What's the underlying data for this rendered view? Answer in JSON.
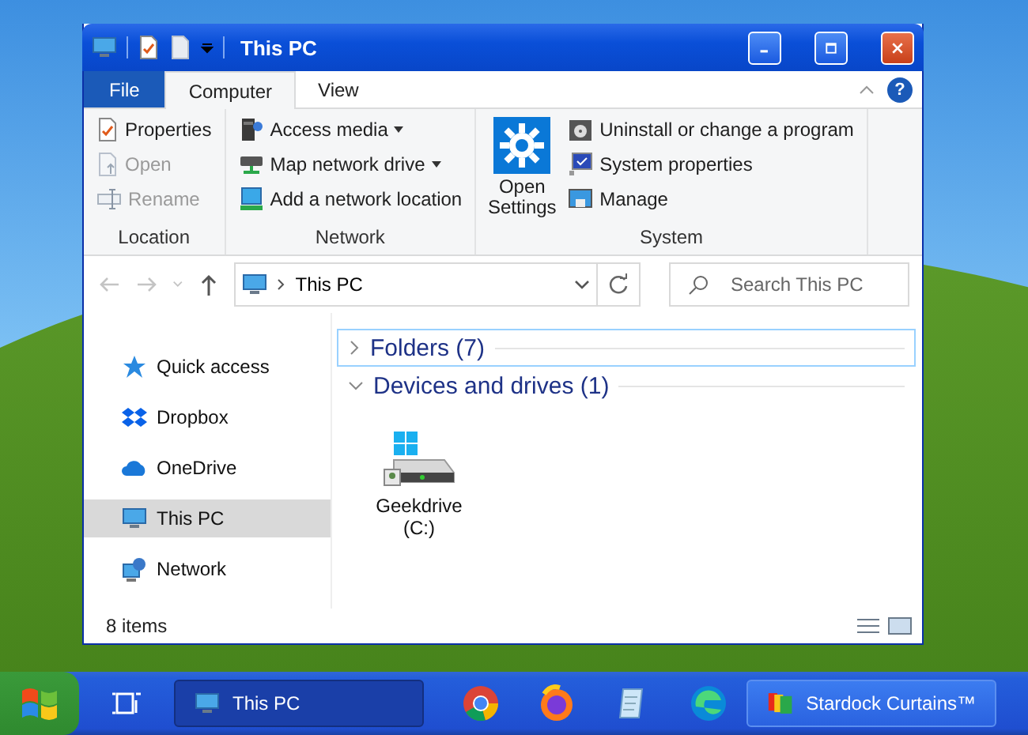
{
  "window": {
    "title": "This PC"
  },
  "ribbon_tabs": [
    {
      "label": "File",
      "kind": "file",
      "selected": false
    },
    {
      "label": "Computer",
      "kind": "tab",
      "selected": true
    },
    {
      "label": "View",
      "kind": "tab",
      "selected": false
    }
  ],
  "help_button": "?",
  "ribbon_groups": [
    {
      "label": "Location",
      "items": [
        {
          "label": "Properties",
          "kind": "small",
          "disabled": false,
          "dropdown": false
        },
        {
          "label": "Open",
          "kind": "small",
          "disabled": true,
          "dropdown": false
        },
        {
          "label": "Rename",
          "kind": "small",
          "disabled": true,
          "dropdown": false
        }
      ]
    },
    {
      "label": "Network",
      "items": [
        {
          "label": "Access media",
          "kind": "small",
          "disabled": false,
          "dropdown": true
        },
        {
          "label": "Map network drive",
          "kind": "small",
          "disabled": false,
          "dropdown": true
        },
        {
          "label": "Add a network location",
          "kind": "small",
          "disabled": false,
          "dropdown": false
        }
      ]
    },
    {
      "label": "System",
      "items": [
        {
          "label": "Open Settings",
          "kind": "large",
          "disabled": false,
          "dropdown": false
        },
        {
          "label": "Uninstall or change a program",
          "kind": "small",
          "disabled": false,
          "dropdown": false
        },
        {
          "label": "System properties",
          "kind": "small",
          "disabled": false,
          "dropdown": false
        },
        {
          "label": "Manage",
          "kind": "small",
          "disabled": false,
          "dropdown": false
        }
      ]
    }
  ],
  "navigation": {
    "back_disabled": true,
    "forward_disabled": true,
    "up_disabled": false
  },
  "address_bar": {
    "path": "This PC"
  },
  "search": {
    "placeholder": "Search This PC"
  },
  "sidebar": {
    "items": [
      {
        "label": "Quick access",
        "selected": false
      },
      {
        "label": "Dropbox",
        "selected": false
      },
      {
        "label": "OneDrive",
        "selected": false
      },
      {
        "label": "This PC",
        "selected": true
      },
      {
        "label": "Network",
        "selected": false
      }
    ]
  },
  "groups": [
    {
      "label": "Folders (7)",
      "expanded": false,
      "focused": true
    },
    {
      "label": "Devices and drives (1)",
      "expanded": true,
      "focused": false,
      "items": [
        {
          "label": "Geekdrive (C:)"
        }
      ]
    }
  ],
  "status_bar": {
    "text": "8 items"
  },
  "taskbar": {
    "items": [
      {
        "kind": "taskview"
      },
      {
        "kind": "window",
        "label": "This PC",
        "selected": true
      },
      {
        "kind": "icon",
        "selected": false
      },
      {
        "kind": "icon",
        "selected": false
      },
      {
        "kind": "icon",
        "selected": false
      },
      {
        "kind": "icon",
        "selected": false
      },
      {
        "kind": "window",
        "label": "Stardock Curtains™",
        "selected": false
      }
    ]
  }
}
